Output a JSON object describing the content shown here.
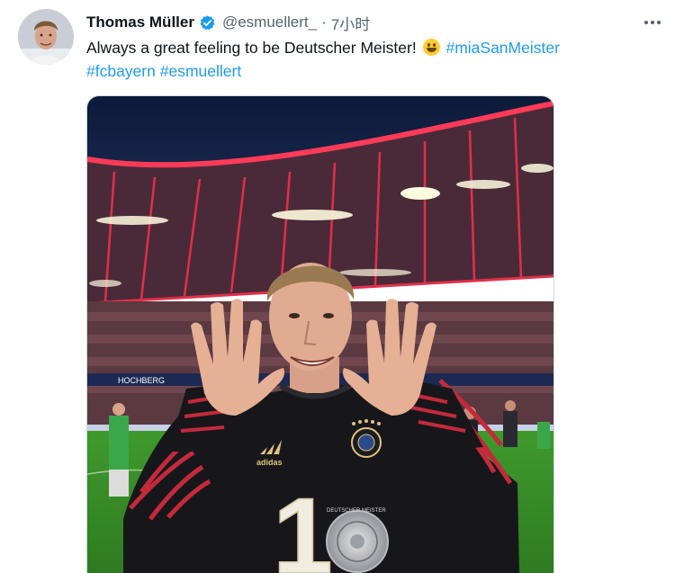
{
  "tweet": {
    "author_name": "Thomas Müller",
    "handle": "@esmuellert_",
    "separator": "·",
    "time": "7小时",
    "text_before_emoji": "Always a great feeling to be Deutscher Meister!",
    "emoji": "grinning-face",
    "hashtags": [
      "#miaSanMeister",
      "#fcbayern",
      "#esmuellert"
    ]
  },
  "photo": {
    "board_text": "HOCHBERG",
    "jersey_brand": "adidas",
    "jersey_number": "1",
    "medal_text": "DEUTSCHER MEISTER"
  },
  "colors": {
    "link": "#1d9bf0",
    "verified": "#1d9bf0",
    "muted": "#536471",
    "stadium_red": "#e0304a",
    "pitch_green": "#3c8f2a"
  }
}
